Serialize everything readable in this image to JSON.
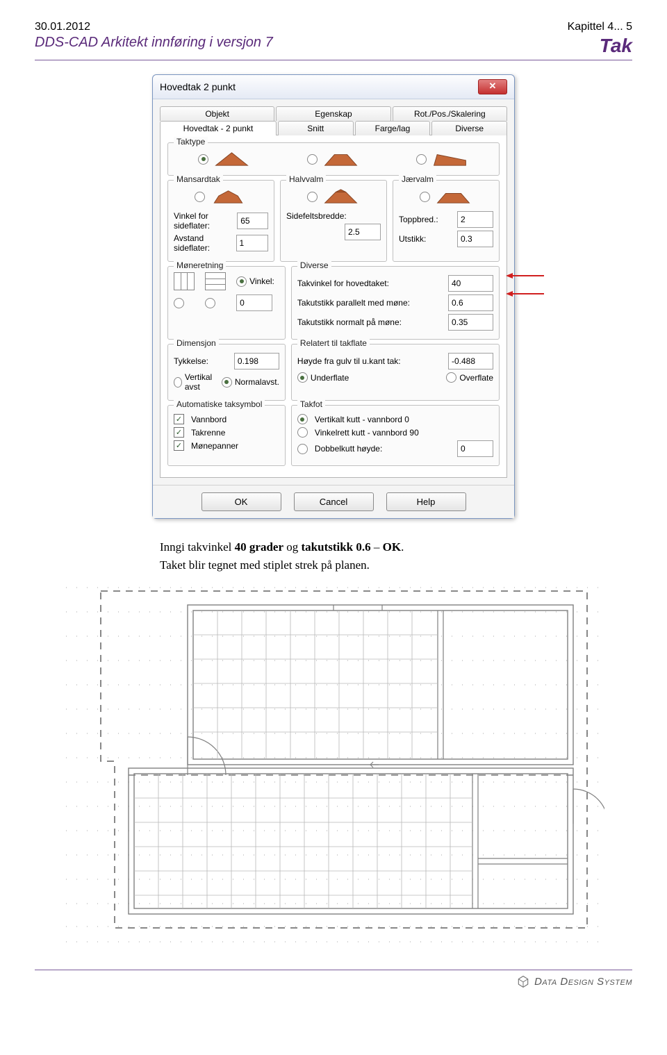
{
  "header": {
    "date": "30.01.2012",
    "chapter": "Kapittel 4... 5",
    "doc_title": "DDS-CAD Arkitekt innføring i versjon 7",
    "section": "Tak"
  },
  "dialog": {
    "title": "Hovedtak 2 punkt",
    "tabs_top": [
      "Objekt",
      "Egenskap",
      "Rot./Pos./Skalering"
    ],
    "tabs_second": [
      "Hovedtak - 2 punkt",
      "Snitt",
      "Farge/lag",
      "Diverse"
    ],
    "taktype_label": "Taktype",
    "mansard": {
      "label": "Mansardtak",
      "vinkel_side_label": "Vinkel for sideflater:",
      "vinkel_side": "65",
      "avstand_label": "Avstand sideflater:",
      "avstand": "1"
    },
    "halvvalm": {
      "label": "Halvvalm",
      "sidefelt_label": "Sidefeltsbredde:",
      "sidefelt": "2.5"
    },
    "jaervalm": {
      "label": "Jærvalm",
      "topp_label": "Toppbred.:",
      "topp": "2",
      "utstikk_label": "Utstikk:",
      "utstikk": "0.3"
    },
    "moneretning": {
      "label": "Møneretning",
      "vinkel_label": "Vinkel:",
      "vinkel": "0"
    },
    "diverse": {
      "label": "Diverse",
      "takvinkel_label": "Takvinkel for hovedtaket:",
      "takvinkel": "40",
      "parallelt_label": "Takutstikk parallelt med møne:",
      "parallelt": "0.6",
      "normalt_label": "Takutstikk normalt på møne:",
      "normalt": "0.35"
    },
    "dimensjon": {
      "label": "Dimensjon",
      "tykkelse_label": "Tykkelse:",
      "tykkelse": "0.198",
      "vert_label": "Vertikal avst",
      "norm_label": "Normalavst."
    },
    "relatert": {
      "label": "Relatert til takflate",
      "hoyde_label": "Høyde fra gulv til u.kant tak:",
      "hoyde": "-0.488",
      "under_label": "Underflate",
      "over_label": "Overflate"
    },
    "autosymbol": {
      "label": "Automatiske taksymbol",
      "vannbord": "Vannbord",
      "takrenne": "Takrenne",
      "monepanner": "Mønepanner"
    },
    "takfot": {
      "label": "Takfot",
      "vkutt": "Vertikalt kutt - vannbord 0",
      "vinkelrett": "Vinkelrett kutt - vannbord 90",
      "dobbel_label": "Dobbelkutt høyde:",
      "dobbel": "0"
    },
    "buttons": {
      "ok": "OK",
      "cancel": "Cancel",
      "help": "Help"
    }
  },
  "body": {
    "line1a": "Inngi takvinkel ",
    "line1b": "40 grader",
    "line1c": " og ",
    "line1d": "takutstikk 0.6",
    "line1e": " – ",
    "line1f": "OK",
    "line1g": ".",
    "line2": "Taket blir tegnet med stiplet strek på planen."
  },
  "footer": {
    "brand_a": "Data ",
    "brand_b": "Design ",
    "brand_c": "System"
  }
}
